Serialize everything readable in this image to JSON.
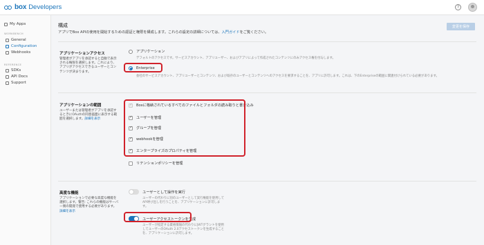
{
  "app": {
    "brand": "box",
    "name": "Developers"
  },
  "topbar": {
    "help": "?"
  },
  "sidebar": {
    "my_apps": "My Apps",
    "section_workbench": "WORKBENCH",
    "general": "General",
    "configuration": "Configuration",
    "webhooks": "Webhooks",
    "section_reference": "REFERENCE",
    "sdks": "SDKs",
    "api_docs": "API Docs",
    "support": "Support"
  },
  "main": {
    "title": "構成",
    "desc_prefix": "アプリでBox APIの使用を開始するための認証と権限を構成します。これらの設定の詳細については、",
    "desc_link": "入門ガイド",
    "desc_suffix": "をご覧ください。",
    "save_button": "変更を保存"
  },
  "access": {
    "title": "アプリケーションアクセス",
    "desc": "管理者がアプリを承認すると自動で表示される権限を選択します。これにより、アプリがアクセスできるユーザーとコンテンツが決まります。",
    "opt1_label": "アプリケーション",
    "opt1_desc": "デフォルトのアクセスです。サービスアカウント、アプリユーザー、およびアプリによって作成されたコンテンツにのみアクセス権を付与します。",
    "opt2_label": "Enterprise",
    "opt2_desc": "会社のサービスアカウント、アプリユーザーとコンテンツ、および既存のユーザーとコンテンツへのアクセスを要求することを、アプリに許可します。これは、下のEnterpriseの範囲に関連付けられている必要があります。"
  },
  "scopes": {
    "title": "アプリケーションの範囲",
    "desc": "ユーザーまたは管理者がアプリを承認するときにOAuthの同意画面に表示する範囲を選択します。",
    "desc_link": "詳細を表示",
    "items": [
      {
        "label": "Boxに格納されているすべてのファイルとフォルダの読み取りと書き込み",
        "state": "disabled-checked"
      },
      {
        "label": "ユーザーを管理",
        "state": "checked"
      },
      {
        "label": "グループを管理",
        "state": "checked"
      },
      {
        "label": "webhookを管理",
        "state": "checked"
      },
      {
        "label": "エンタープライズのプロパティを管理",
        "state": "checked"
      },
      {
        "label": "リテンションポリシーを管理",
        "state": "unchecked"
      }
    ]
  },
  "advanced": {
    "title": "高度な機能",
    "desc": "アプリケーションで必要な高度な機能を選択します。警告: これらの機能はサーバー側の開発で使用する必要があります。",
    "desc_link": "詳細を表示",
    "opt1_label": "ユーザーとして操作を実行",
    "opt1_desc": "ユーザーの代わりに別のユーザーとして実行権能を使用してAPI呼び出しを行うことを、アプリケーションに許可します。",
    "opt2_label": "ユーザーアクセストークンを生成",
    "opt2_desc": "ユーザーが指定する資格情報の代わりにJWTグラントを使用してユーザーのOAuth 2.0アクセストークンを生成することを、アプリケーションに許可します。"
  },
  "colors": {
    "accent": "#1a74ba",
    "highlight": "#d0212a"
  }
}
